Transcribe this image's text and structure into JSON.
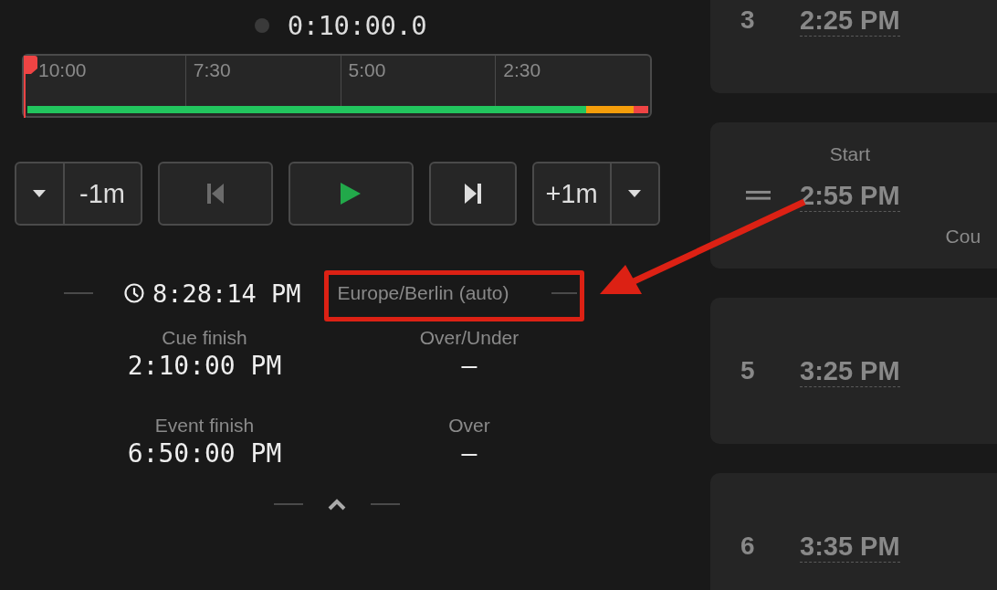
{
  "timer": {
    "running": false,
    "value": "0:10:00.0"
  },
  "timeline": {
    "ticks": [
      "10:00",
      "7:30",
      "5:00",
      "2:30"
    ],
    "playhead": {
      "level": 0
    },
    "zones": [
      {
        "color": "#22c55e"
      },
      {
        "color": "#f59e0b"
      },
      {
        "color": "#ef4444"
      }
    ]
  },
  "controls": [
    {
      "kind": "menu",
      "disabled": false
    },
    {
      "kind": "text",
      "label": "-1m",
      "disabled": false
    },
    {
      "kind": "previous",
      "disabled": true
    },
    {
      "kind": "play",
      "disabled": false
    },
    {
      "kind": "next",
      "disabled": false
    },
    {
      "kind": "text",
      "label": "+1m",
      "disabled": false
    },
    {
      "kind": "menu",
      "disabled": false
    }
  ],
  "clock": {
    "time": "8:28:14 PM",
    "timezone": "Europe/Berlin (auto)"
  },
  "stats": [
    {
      "label": "Cue finish",
      "value": "2:10:00 PM"
    },
    {
      "label": "Over/Under",
      "value": "–"
    },
    {
      "label": "Event finish",
      "value": "6:50:00 PM"
    },
    {
      "label": "Over",
      "value": "–"
    }
  ],
  "annotation": {
    "kind": "highlight"
  },
  "cards": [
    {
      "kind": "numbered",
      "number": "3",
      "start": "2:25 PM"
    },
    {
      "kind": "dragging",
      "start_label": "Start",
      "start": "2:55 PM",
      "column_3_label": "Cou"
    },
    {
      "kind": "numbered",
      "number": "5",
      "start": "3:25 PM"
    },
    {
      "kind": "numbered",
      "number": "6",
      "start": "3:35 PM"
    }
  ]
}
